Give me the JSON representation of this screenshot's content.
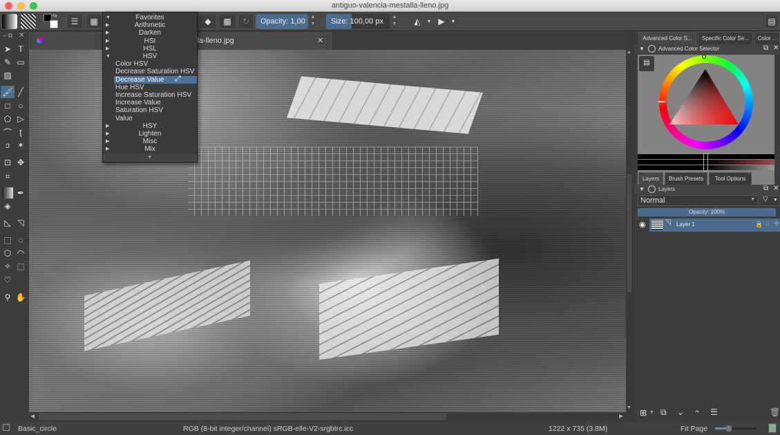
{
  "window": {
    "title": "antiguo-valencia-mestalla-lleno.jpg"
  },
  "toolbar": {
    "opacity_label": "Opacity:",
    "opacity_value": "1,00",
    "size_label": "Size:",
    "size_value": "100,00 px"
  },
  "document": {
    "tab_title": "antiguo-valencia-mestalla-lleno.jpg",
    "tab_visible_title": "lla-lleno.jpg"
  },
  "blend_popup": {
    "categories_before": [
      {
        "label": "Favorites",
        "expanded": true
      },
      {
        "label": "Arithmetic",
        "expanded": false
      },
      {
        "label": "Darken",
        "expanded": false
      },
      {
        "label": "HSI",
        "expanded": false
      },
      {
        "label": "HSL",
        "expanded": false
      },
      {
        "label": "HSV",
        "expanded": true
      }
    ],
    "hsv_items": [
      "Color HSV",
      "Decrease Saturation HSV",
      "Decrease Value",
      "Hue HSV",
      "Increase Saturation HSV",
      "Increase Value",
      "Saturation HSV",
      "Value"
    ],
    "selected_item": "Decrease Value",
    "categories_after": [
      {
        "label": "HSY",
        "expanded": false
      },
      {
        "label": "Lighten",
        "expanded": false
      },
      {
        "label": "Misc",
        "expanded": false
      },
      {
        "label": "Mix",
        "expanded": false
      }
    ]
  },
  "color_dock": {
    "tabs": [
      "Advanced Color S...",
      "Specific Color Se...",
      "Color ..."
    ],
    "panel_title": "Advanced Color Selector",
    "current_color": "#e00000"
  },
  "layers_dock": {
    "tabs": [
      "Layers",
      "Brush Presets",
      "Tool Options"
    ],
    "panel_title": "Layers",
    "blend_mode": "Normal",
    "opacity_label": "Opacity:  100%",
    "layers": [
      {
        "name": "Layer 1",
        "visible": true
      }
    ]
  },
  "statusbar": {
    "brush": "Basic_circle",
    "color_info": "RGB (8-bit integer/channel)  sRGB-elle-V2-srgbtrc.icc",
    "image_size": "1222 x 735 (3.8M)",
    "zoom_mode": "Fit Page"
  },
  "colors": {
    "accent": "#4c7199",
    "field_blue": "#4a6d8f",
    "panel_bg": "#3d3d3d"
  }
}
